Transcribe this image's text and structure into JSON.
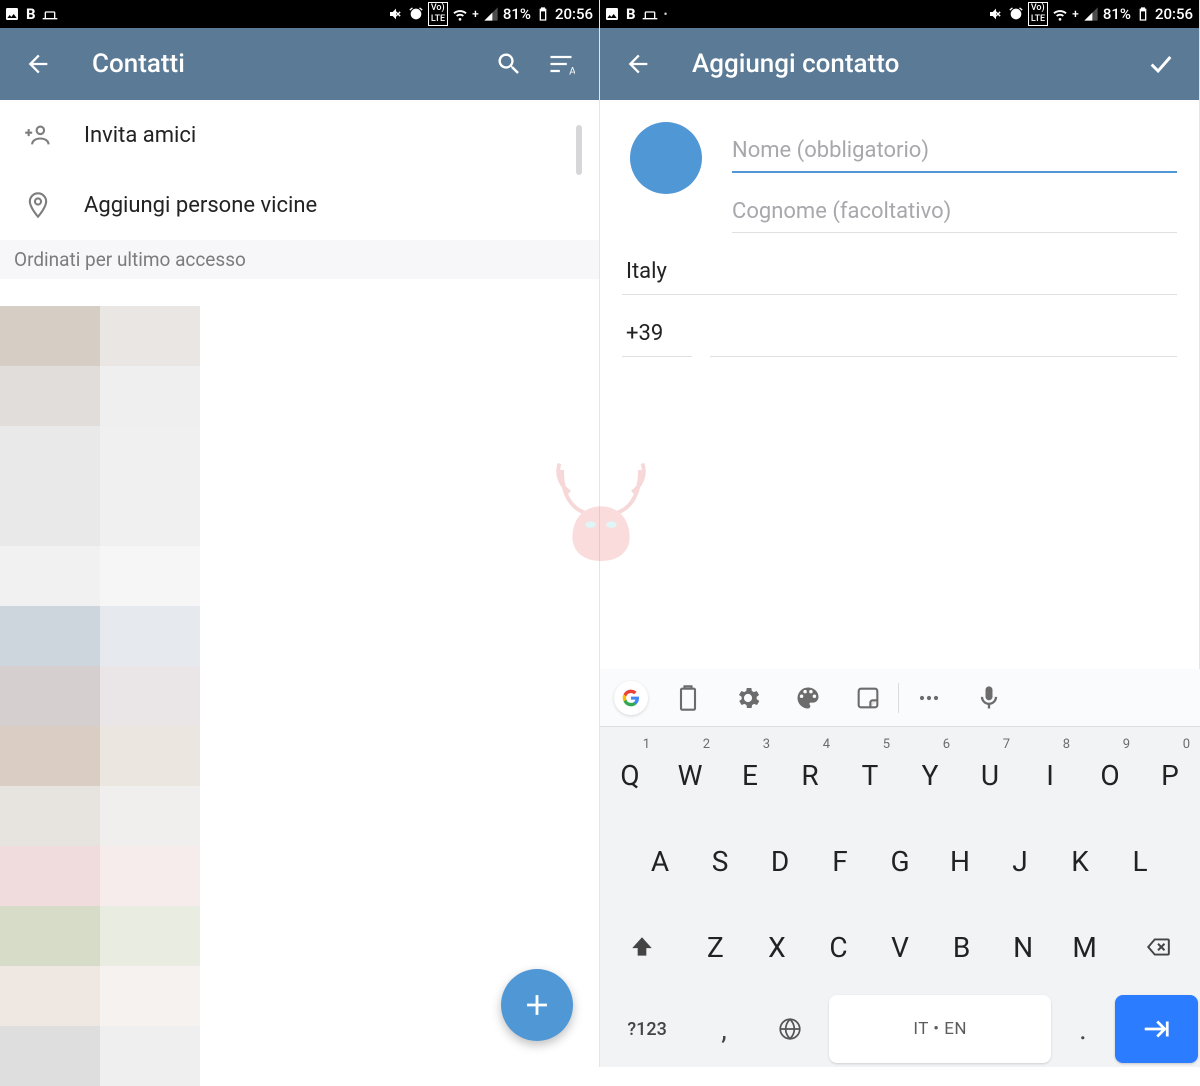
{
  "status": {
    "battery": "81%",
    "time": "20:56",
    "left_letter": "B"
  },
  "left": {
    "title": "Contatti",
    "invite": "Invita amici",
    "nearby": "Aggiungi persone vicine",
    "section": "Ordinati per ultimo accesso",
    "pixel_colors_a": [
      "#d6cdc5",
      "#e0dddb",
      "#e9e9e9",
      "#e9e9e9",
      "#f1f1f1",
      "#ced6dd",
      "#d5cfd0",
      "#dacdc3",
      "#e7e4e0",
      "#f0dcdc",
      "#d7dcc9",
      "#efe8e2",
      "#dedede"
    ],
    "pixel_colors_b": [
      "#e9e6e4",
      "#efefef",
      "#f0f0f0",
      "#f0f0f0",
      "#f6f6f6",
      "#e6eaee",
      "#eae6e7",
      "#ece6e1",
      "#f1efed",
      "#f7ecec",
      "#e9ece0",
      "#f6f2ef",
      "#efefef"
    ]
  },
  "right": {
    "title": "Aggiungi contatto",
    "name_ph": "Nome (obbligatorio)",
    "surname_ph": "Cognome (facoltativo)",
    "country": "Italy",
    "prefix": "+39"
  },
  "kbd": {
    "row0_keys": [
      "Q",
      "W",
      "E",
      "R",
      "T",
      "Y",
      "U",
      "I",
      "O",
      "P"
    ],
    "row0_sup": [
      "1",
      "2",
      "3",
      "4",
      "5",
      "6",
      "7",
      "8",
      "9",
      "0"
    ],
    "row1_keys": [
      "A",
      "S",
      "D",
      "F",
      "G",
      "H",
      "J",
      "K",
      "L"
    ],
    "row2_keys": [
      "Z",
      "X",
      "C",
      "V",
      "B",
      "N",
      "M"
    ],
    "sym": "?123",
    "space": "IT • EN",
    "comma": ",",
    "dot": "."
  }
}
